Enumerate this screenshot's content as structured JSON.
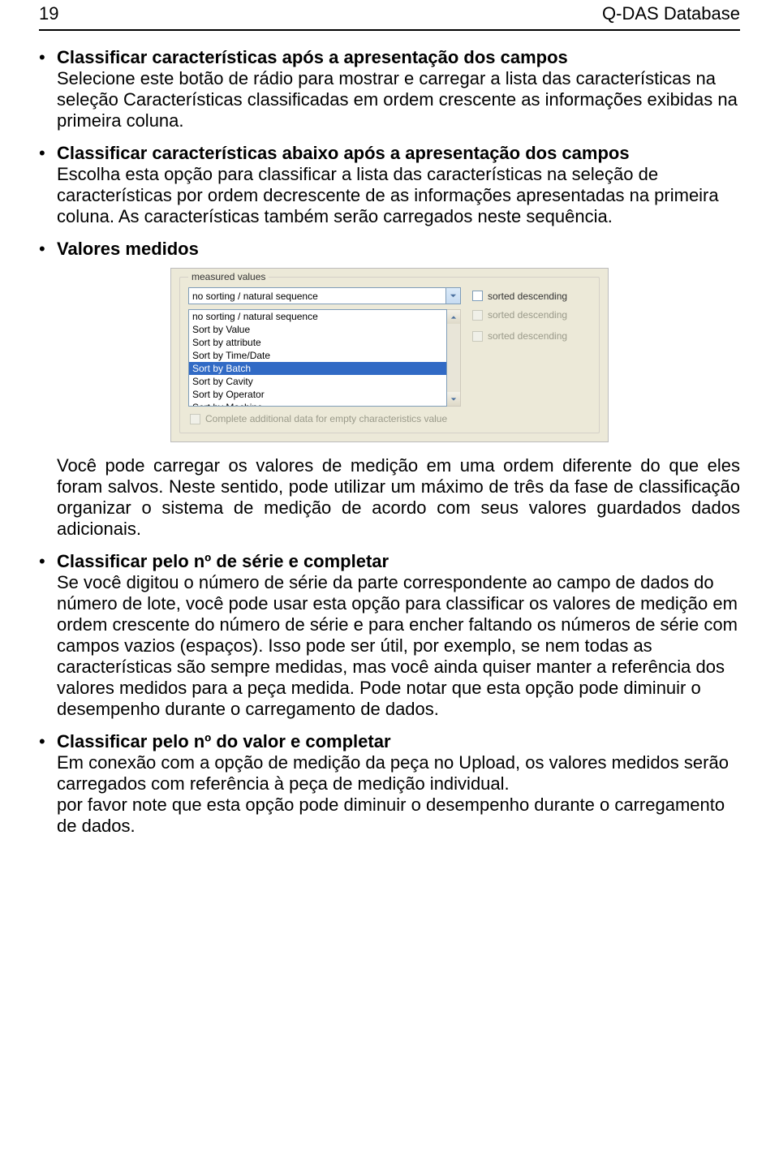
{
  "header": {
    "page": "19",
    "title": "Q-DAS Database"
  },
  "bullets": [
    {
      "title": "Classificar características após a apresentação dos campos",
      "text": "Selecione este botão de rádio para mostrar e carregar a lista das características na seleção Características classificadas em ordem crescente as informações exibidas na primeira coluna."
    },
    {
      "title": "Classificar características abaixo após a apresentação dos campos",
      "text": "Escolha esta opção para classificar a lista das características na seleção de características por ordem decrescente de as informações apresentadas na primeira coluna. As características também serão carregados neste sequência."
    },
    {
      "title": "Valores medidos",
      "text": ""
    }
  ],
  "screenshot": {
    "legend": "measured values",
    "comboSelected": "no sorting / natural sequence",
    "sortedDescendingLabel": "sorted descending",
    "listItems": [
      "no sorting / natural sequence",
      "Sort by Value",
      "Sort by attribute",
      "Sort by Time/Date",
      "Sort by Batch",
      "Sort by Cavity",
      "Sort by Operator",
      "Sort by Machine"
    ],
    "selectedIndex": 4,
    "completeLabel": "Complete additional data for empty characteristics value"
  },
  "afterScreenshot": "Você pode carregar os valores de medição em uma ordem diferente do que eles foram salvos. Neste sentido, pode utilizar um máximo de três da fase de classificação organizar o sistema de medição de acordo com seus valores guardados dados adicionais.",
  "bullets2": [
    {
      "title": "Classificar pelo nº de série e completar",
      "text": "Se você digitou o número de série da parte correspondente ao campo de dados do número de lote, você pode usar esta opção para classificar os valores de medição em ordem crescente do número de série e para encher faltando os números de série com campos vazios (espaços). Isso pode ser útil, por exemplo, se nem todas as características são sempre medidas, mas você ainda quiser manter a referência dos valores medidos para a peça medida. Pode notar que esta opção pode diminuir o desempenho durante o carregamento de dados."
    },
    {
      "title": "Classificar pelo nº do valor e completar",
      "text": "Em conexão com a opção de medição da peça no Upload, os valores medidos serão carregados com referência à peça de medição individual.\npor favor note que esta opção pode diminuir o desempenho durante o carregamento de dados."
    }
  ]
}
